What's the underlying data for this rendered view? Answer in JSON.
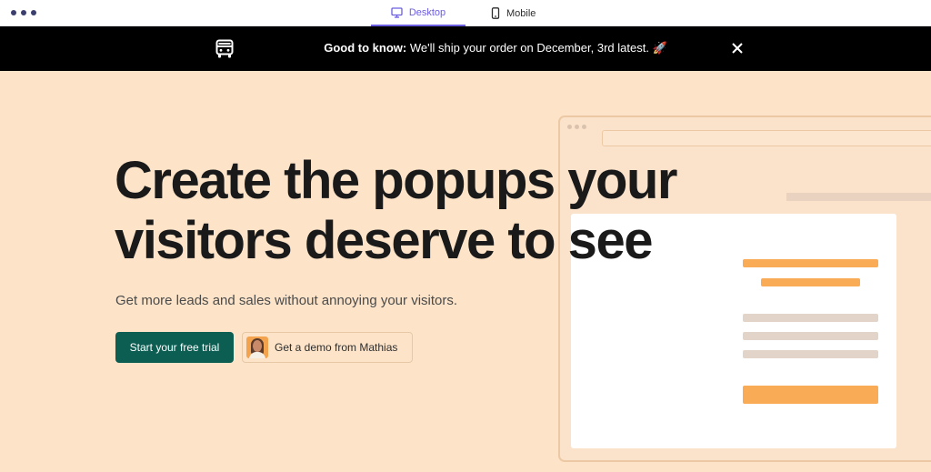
{
  "preview_tabs": {
    "desktop_label": "Desktop",
    "mobile_label": "Mobile",
    "active": "Desktop",
    "accent_color": "#6b5de0"
  },
  "announcement": {
    "lead": "Good to know:",
    "message": " We'll ship your order on December, 3rd latest.",
    "emoji": "🚀",
    "icon": "truck-icon",
    "close_icon": "close-icon"
  },
  "hero": {
    "headline_line1": "Create the popups your",
    "headline_line2": "visitors deserve to see",
    "subline": "Get more leads and sales without annoying your visitors.",
    "primary_button": "Start your free trial",
    "demo_button": "Get a demo from Mathias",
    "background_color": "#fde4c9",
    "primary_color": "#0c5e52"
  }
}
